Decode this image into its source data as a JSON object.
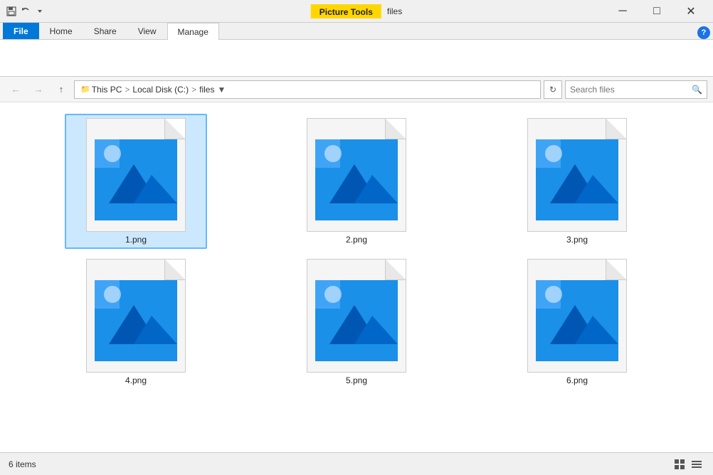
{
  "window": {
    "title": "files",
    "picture_tools_label": "Picture Tools",
    "min_btn": "─",
    "max_btn": "□",
    "close_btn": "✕"
  },
  "ribbon": {
    "tabs": [
      {
        "id": "file",
        "label": "File",
        "active": false,
        "special": true
      },
      {
        "id": "home",
        "label": "Home",
        "active": false
      },
      {
        "id": "share",
        "label": "Share",
        "active": false
      },
      {
        "id": "view",
        "label": "View",
        "active": false
      },
      {
        "id": "manage",
        "label": "Manage",
        "active": true
      }
    ]
  },
  "address_bar": {
    "back_tooltip": "Back",
    "forward_tooltip": "Forward",
    "up_tooltip": "Up",
    "path_parts": [
      "This PC",
      "Local Disk (C:)",
      "files"
    ],
    "search_placeholder": "Search files",
    "search_label": "Search"
  },
  "files": [
    {
      "name": "1.png",
      "selected": true
    },
    {
      "name": "2.png",
      "selected": false
    },
    {
      "name": "3.png",
      "selected": false
    },
    {
      "name": "4.png",
      "selected": false
    },
    {
      "name": "5.png",
      "selected": false
    },
    {
      "name": "6.png",
      "selected": false
    }
  ],
  "status": {
    "item_count": "6 items"
  },
  "help_btn": "?",
  "colors": {
    "accent": "#0078d7",
    "picture_tools_bg": "#ffd700",
    "selected_bg": "#cce8ff",
    "selected_border": "#66b7ff",
    "icon_blue": "#0078d7",
    "icon_light_blue": "#5ab3ff"
  }
}
